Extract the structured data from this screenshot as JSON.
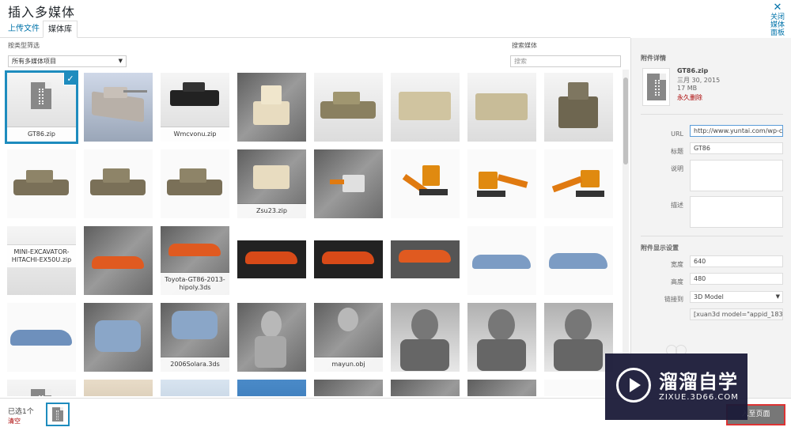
{
  "header": {
    "title": "插入多媒体",
    "close_label": "关闭媒体面板"
  },
  "tabs": [
    {
      "label": "上传文件"
    },
    {
      "label": "媒体库"
    }
  ],
  "toolbar": {
    "filter_label": "按类型筛选",
    "filter_value": "所有多媒体项目",
    "search_label": "搜索媒体",
    "search_placeholder": "搜索"
  },
  "grid": {
    "labels": {
      "gt86zip": "GT86.zip",
      "wmcvonu": "Wmcvonu.zip",
      "zsu23": "Zsu23.zip",
      "mini": "MINI-EXCAVATOR-HITACHI-EX50U.zip",
      "toyota": "Toyota-GT86-2013-hipoly.3ds",
      "solara": "2006Solara.3ds",
      "mayun": "mayun.obj"
    }
  },
  "details": {
    "heading": "附件详情",
    "filename": "GT86.zip",
    "date": "三月 30, 2015",
    "size": "17 MB",
    "delete_label": "永久删除",
    "url_label": "URL",
    "url_value": "http://www.yuntai.com/wp-c",
    "title_label": "标题",
    "title_value": "GT86",
    "caption_label": "说明",
    "description_label": "描述",
    "display_heading": "附件显示设置",
    "width_label": "宽度",
    "width_value": "640",
    "height_label": "高度",
    "height_value": "480",
    "link_label": "链接到",
    "link_value": "3D Model",
    "shortcode_value": "[xuan3d model=\"appid_1834"
  },
  "footer": {
    "selected_count": "已选1个",
    "clear_label": "清空",
    "insert_label": "入至页面"
  },
  "watermark": {
    "title": "溜溜自学",
    "subtitle": "ZIXUE.3D66.COM"
  },
  "colors": {
    "accent": "#1e8cbe",
    "link": "#0073aa",
    "danger": "#aa0000"
  }
}
